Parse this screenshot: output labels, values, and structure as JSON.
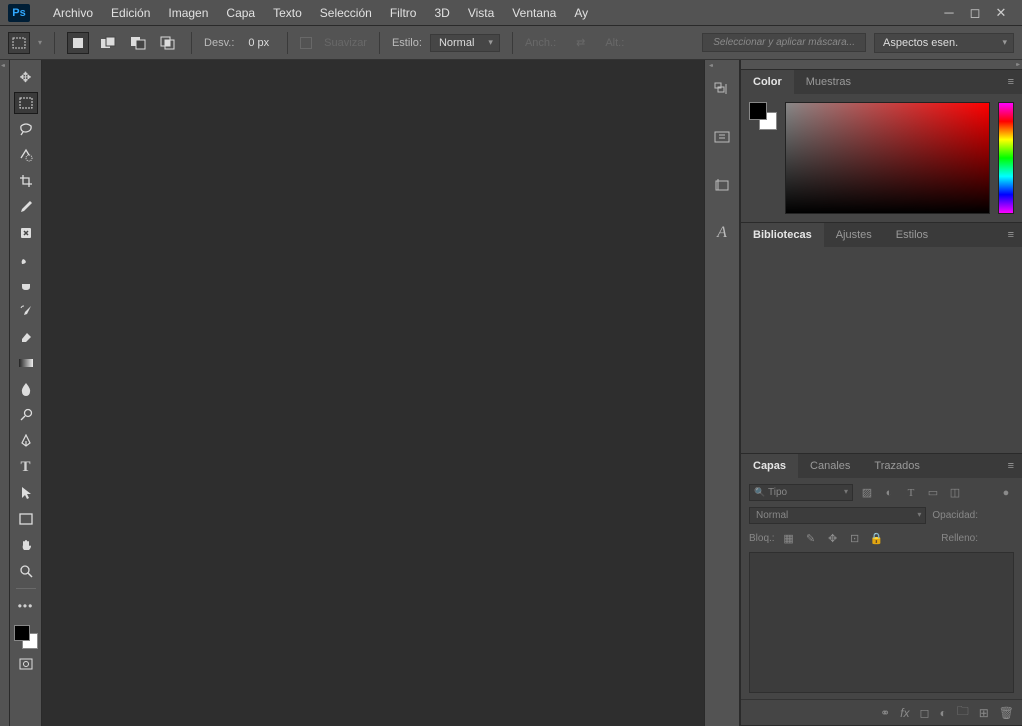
{
  "app": {
    "logo": "Ps"
  },
  "menu": {
    "items": [
      "Archivo",
      "Edición",
      "Imagen",
      "Capa",
      "Texto",
      "Selección",
      "Filtro",
      "3D",
      "Vista",
      "Ventana",
      "Ay"
    ]
  },
  "options": {
    "desv_label": "Desv.:",
    "desv_value": "0 px",
    "suavizar": "Suavizar",
    "estilo_label": "Estilo:",
    "estilo_value": "Normal",
    "anch_label": "Anch.:",
    "alt_label": "Alt.:",
    "mask_btn": "Seleccionar y aplicar máscara...",
    "workspace": "Aspectos esen."
  },
  "panels": {
    "color": {
      "tabs": [
        "Color",
        "Muestras"
      ],
      "active": 0
    },
    "middle": {
      "tabs": [
        "Bibliotecas",
        "Ajustes",
        "Estilos"
      ],
      "active": 0
    },
    "layers": {
      "tabs": [
        "Capas",
        "Canales",
        "Trazados"
      ],
      "active": 0,
      "filter": "Tipo",
      "blend": "Normal",
      "opacity_label": "Opacidad:",
      "lock_label": "Bloq.:",
      "fill_label": "Relleno:"
    }
  }
}
